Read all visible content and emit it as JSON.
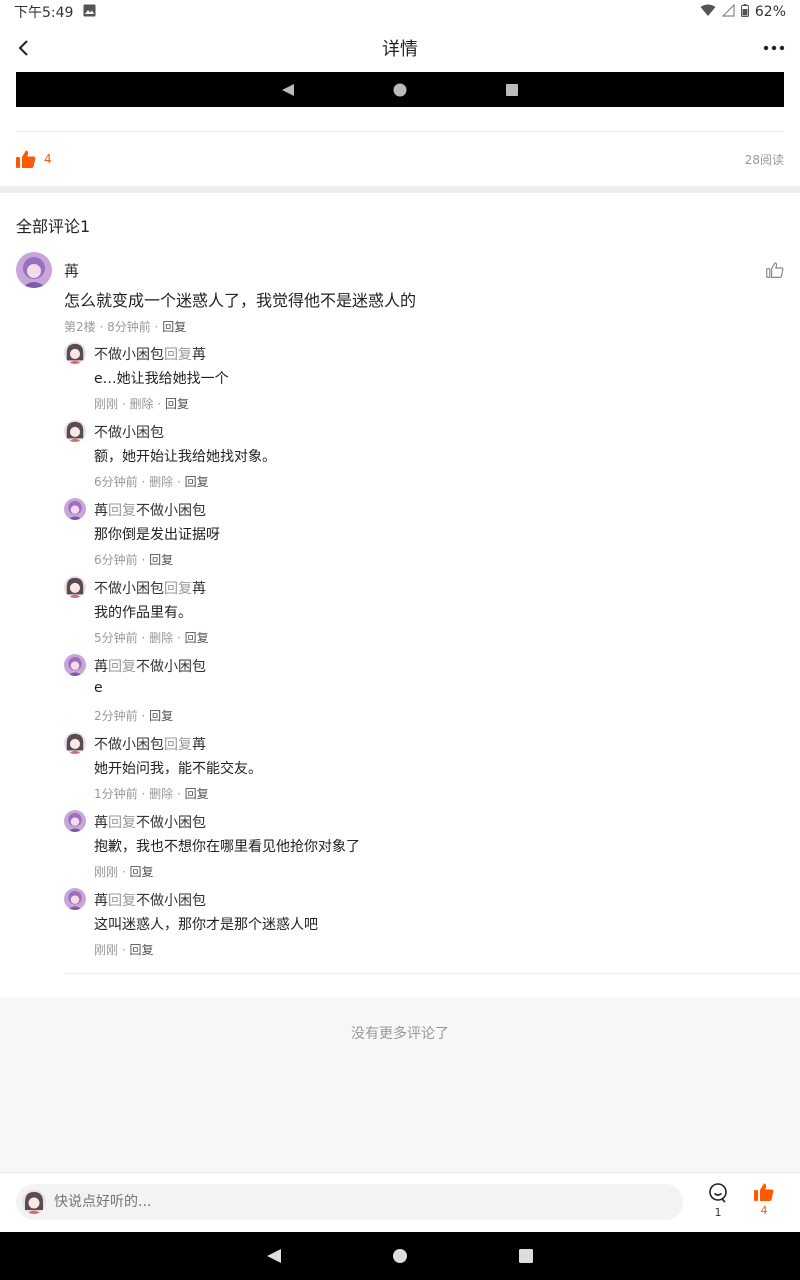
{
  "status_bar": {
    "time": "下午5:49",
    "battery": "62%"
  },
  "nav": {
    "title": "详情"
  },
  "post": {
    "like_count": "4",
    "read_count": "28阅读"
  },
  "comments_header": "全部评论1",
  "main_comment": {
    "name": "苒",
    "text": "怎么就变成一个迷惑人了，我觉得他不是迷惑人的",
    "floor": "第2楼",
    "time": "8分钟前",
    "reply": "回复"
  },
  "reply_word": "回复",
  "delete_word": "删除",
  "replies": [
    {
      "avatar": "girl",
      "from": "不做小困包",
      "to": "苒",
      "text": "e…她让我给她找一个",
      "time": "刚刚",
      "deletable": true
    },
    {
      "avatar": "girl",
      "from": "不做小困包",
      "to": "",
      "text": "额，她开始让我给她找对象。",
      "time": "6分钟前",
      "deletable": true
    },
    {
      "avatar": "purple",
      "from": "苒",
      "to": "不做小困包",
      "text": "那你倒是发出证据呀",
      "time": "6分钟前",
      "deletable": false
    },
    {
      "avatar": "girl",
      "from": "不做小困包",
      "to": "苒",
      "text": "我的作品里有。",
      "time": "5分钟前",
      "deletable": true
    },
    {
      "avatar": "purple",
      "from": "苒",
      "to": "不做小困包",
      "text": "e",
      "time": "2分钟前",
      "deletable": false
    },
    {
      "avatar": "girl",
      "from": "不做小困包",
      "to": "苒",
      "text": "她开始问我，能不能交友。",
      "time": "1分钟前",
      "deletable": true
    },
    {
      "avatar": "purple",
      "from": "苒",
      "to": "不做小困包",
      "text": "抱歉，我也不想你在哪里看见他抢你对象了",
      "time": "刚刚",
      "deletable": false
    },
    {
      "avatar": "purple",
      "from": "苒",
      "to": "不做小困包",
      "text": "这叫迷惑人，那你才是那个迷惑人吧",
      "time": "刚刚",
      "deletable": false
    }
  ],
  "footer_text": "没有更多评论了",
  "bottom_bar": {
    "placeholder": "快说点好听的...",
    "comment_count": "1",
    "like_count": "4"
  },
  "colors": {
    "accent": "#ff5a00",
    "muted": "#999999"
  }
}
